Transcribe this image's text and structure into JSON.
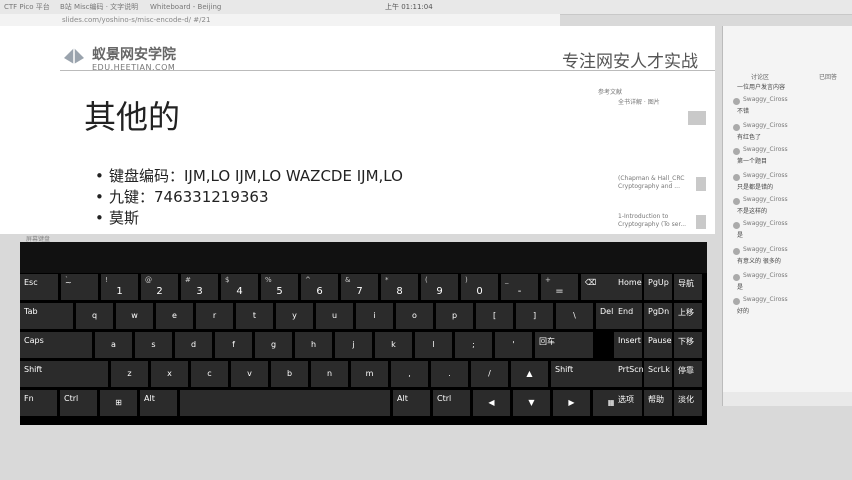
{
  "browser": {
    "tabs": [
      "CTF Pico 平台",
      "B站 Misc编码 · 文字说明",
      "Whiteboard - Beijing"
    ],
    "clock": "上午 01:11:04",
    "url": "slides.com/yoshino-s/misc-encode-d/ #/21"
  },
  "slide": {
    "logo_name": "蚁景网安学院",
    "logo_url": "EDU.HEETIAN.COM",
    "slogan": "专注网安人才实战",
    "title": "其他的",
    "bullets": [
      "键盘编码：IJM,LO IJM,LO WAZCDE IJM,LO",
      "九键：746331219363",
      "莫斯"
    ]
  },
  "right_panel": {
    "items": [
      "参考文献",
      "全书详解 · 图片",
      "(Chapman & Hall_CRC Cryptography and ...",
      "1-Introduction to Cryptography (To ser..."
    ]
  },
  "chat": {
    "tab": "讨论区",
    "sub": "已回答",
    "messages": [
      {
        "name": "Swaggy_Ciross",
        "text": "一位用户发言内容"
      },
      {
        "name": "Swaggy_Ciross",
        "text": "不错"
      },
      {
        "name": "Swaggy_Ciross",
        "text": "有红色了"
      },
      {
        "name": "Swaggy_Ciross",
        "text": "第一个题目"
      },
      {
        "name": "Swaggy_Ciross",
        "text": "只是都是错的"
      },
      {
        "name": "Swaggy_Ciross",
        "text": "不是这样的"
      },
      {
        "name": "Swaggy_Ciross",
        "text": "是"
      },
      {
        "name": "Swaggy_Ciross",
        "text": "有意义的 很多的"
      },
      {
        "name": "Swaggy_Ciross",
        "text": "是"
      },
      {
        "name": "Swaggy_Ciross",
        "text": "好的"
      }
    ]
  },
  "osk": {
    "label": "屏幕键盘",
    "row1": [
      {
        "m": "Esc"
      },
      {
        "m": "~",
        "s": "`"
      },
      {
        "b": "1",
        "s": "!"
      },
      {
        "b": "2",
        "s": "@"
      },
      {
        "b": "3",
        "s": "#"
      },
      {
        "b": "4",
        "s": "$"
      },
      {
        "b": "5",
        "s": "%"
      },
      {
        "b": "6",
        "s": "^"
      },
      {
        "b": "7",
        "s": "&"
      },
      {
        "b": "8",
        "s": "*"
      },
      {
        "b": "9",
        "s": "("
      },
      {
        "b": "0",
        "s": ")"
      },
      {
        "b": "-",
        "s": "_"
      },
      {
        "b": "=",
        "s": "+"
      },
      {
        "m": "⌫"
      }
    ],
    "row2": [
      "Tab",
      "q",
      "w",
      "e",
      "r",
      "t",
      "y",
      "u",
      "i",
      "o",
      "p",
      "[",
      "]",
      "\\",
      "Del"
    ],
    "row3": [
      "Caps",
      "a",
      "s",
      "d",
      "f",
      "g",
      "h",
      "j",
      "k",
      "l",
      ";",
      "'",
      "回车"
    ],
    "row4": [
      "Shift",
      "z",
      "x",
      "c",
      "v",
      "b",
      "n",
      "m",
      ",",
      ".",
      "/",
      "▲",
      "Shift"
    ],
    "row5": [
      "Fn",
      "Ctrl",
      "⊞",
      "Alt",
      "",
      "Alt",
      "Ctrl",
      "◀",
      "▼",
      "▶",
      "▦"
    ],
    "nav": [
      [
        "Home",
        "PgUp",
        "导航"
      ],
      [
        "End",
        "PgDn",
        "上移"
      ],
      [
        "Insert",
        "Pause",
        "下移"
      ],
      [
        "PrtScn",
        "ScrLk",
        "停靠"
      ],
      [
        "选项",
        "帮助",
        "淡化"
      ]
    ]
  }
}
